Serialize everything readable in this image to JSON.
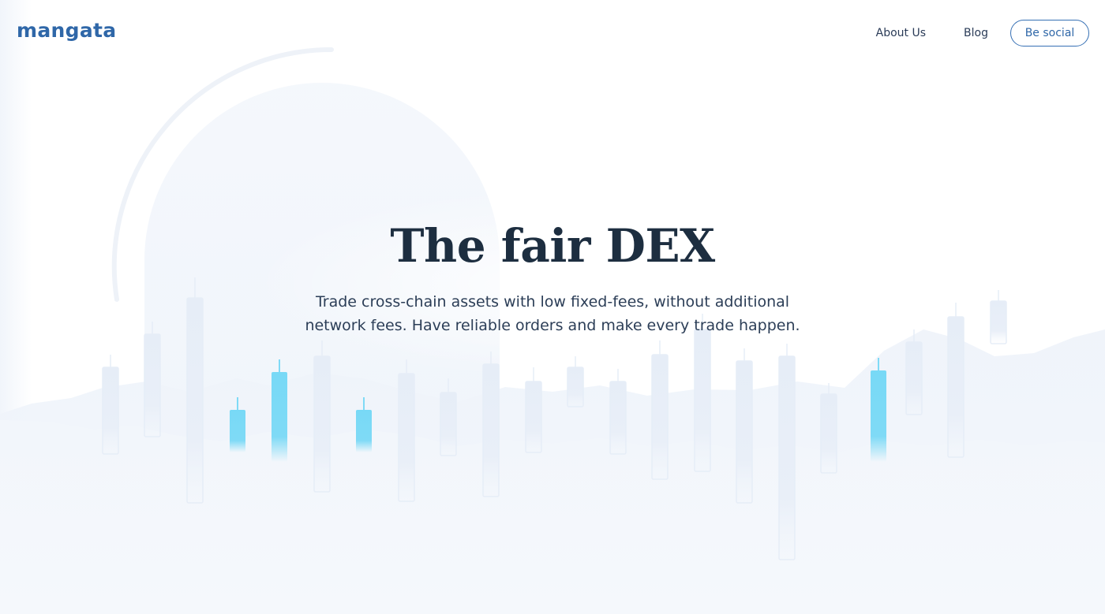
{
  "brand": {
    "logo_text": "mangata",
    "primary_color": "#2f67a8"
  },
  "nav": {
    "items": [
      {
        "label": "About Us"
      },
      {
        "label": "Blog"
      }
    ],
    "cta_label": "Be social"
  },
  "hero": {
    "title": "The fair DEX",
    "subtitle_lines": [
      "Trade cross-chain assets with low fixed-fees, without additional",
      "network fees. Have reliable orders and make every trade happen."
    ]
  },
  "colors": {
    "heading": "#1d2e40",
    "text": "#2c3e57",
    "highlight_candle": "#7fdaf6",
    "faint_candle": "#e8eef7"
  }
}
